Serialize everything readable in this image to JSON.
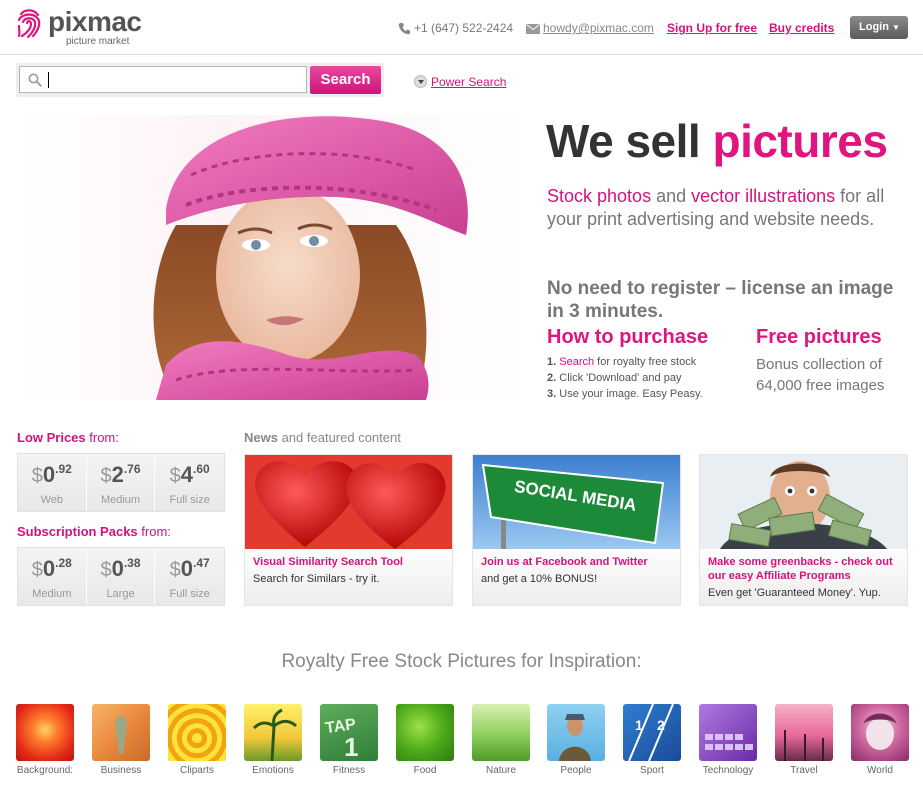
{
  "header": {
    "logo_name": "pixmac",
    "logo_tagline": "picture market",
    "phone": "+1 (647) 522-2424",
    "email": "howdy@pixmac.com",
    "signup_label": "Sign Up for free",
    "buy_label": "Buy credits",
    "login_label": "Login"
  },
  "search": {
    "button_label": "Search",
    "power_label": "Power Search"
  },
  "hero": {
    "title_part1": "We sell ",
    "title_part2": "pictures",
    "p1_a": "Stock photos",
    "p1_b": " and ",
    "p1_c": "vector illustrations",
    "p1_d": " for all your print advertising and website needs.",
    "p2": "No need to register – license an image in 3 minutes.",
    "how_title": "How to purchase",
    "how_steps": [
      {
        "num": "1.",
        "link": "Search",
        "text": " for royalty free stock"
      },
      {
        "num": "2.",
        "link": "",
        "text": " Click 'Download' and pay"
      },
      {
        "num": "3.",
        "link": "",
        "text": " Use your image. Easy Peasy."
      }
    ],
    "free_title": "Free pictures",
    "free_text": "Bonus collection of 64,000 free images"
  },
  "prices": {
    "low_label": "Low Prices",
    "low_from": " from:",
    "low": [
      {
        "whole": "0",
        "cents": ".92",
        "label": "Web"
      },
      {
        "whole": "2",
        "cents": ".76",
        "label": "Medium"
      },
      {
        "whole": "4",
        "cents": ".60",
        "label": "Full size"
      }
    ],
    "sub_label": "Subscription Packs",
    "sub_from": " from:",
    "sub": [
      {
        "whole": "0",
        "cents": ".28",
        "label": "Medium"
      },
      {
        "whole": "0",
        "cents": ".38",
        "label": "Large"
      },
      {
        "whole": "0",
        "cents": ".47",
        "label": "Full size"
      }
    ],
    "currency": "$"
  },
  "news": {
    "heading_a": "News",
    "heading_b": " and featured content",
    "cards": [
      {
        "title": "Visual Similarity Search Tool",
        "sub": "Search for Similars - try it."
      },
      {
        "title": "Join us at Facebook and Twitter",
        "sub": "and get a 10% BONUS!",
        "sign_text": "SOCIAL MEDIA"
      },
      {
        "title": "Make some greenbacks - check out our easy Affiliate Programs",
        "sub": "Even get 'Guaranteed Money'. Yup."
      }
    ]
  },
  "inspiration": {
    "heading": "Royalty Free Stock Pictures for Inspiration:",
    "categories": [
      "Background:",
      "Business",
      "Cliparts",
      "Emotions",
      "Fitness",
      "Food",
      "Nature",
      "People",
      "Sport",
      "Technology",
      "Travel",
      "World"
    ]
  },
  "colors": {
    "accent": "#d4127c",
    "text": "#555555"
  }
}
